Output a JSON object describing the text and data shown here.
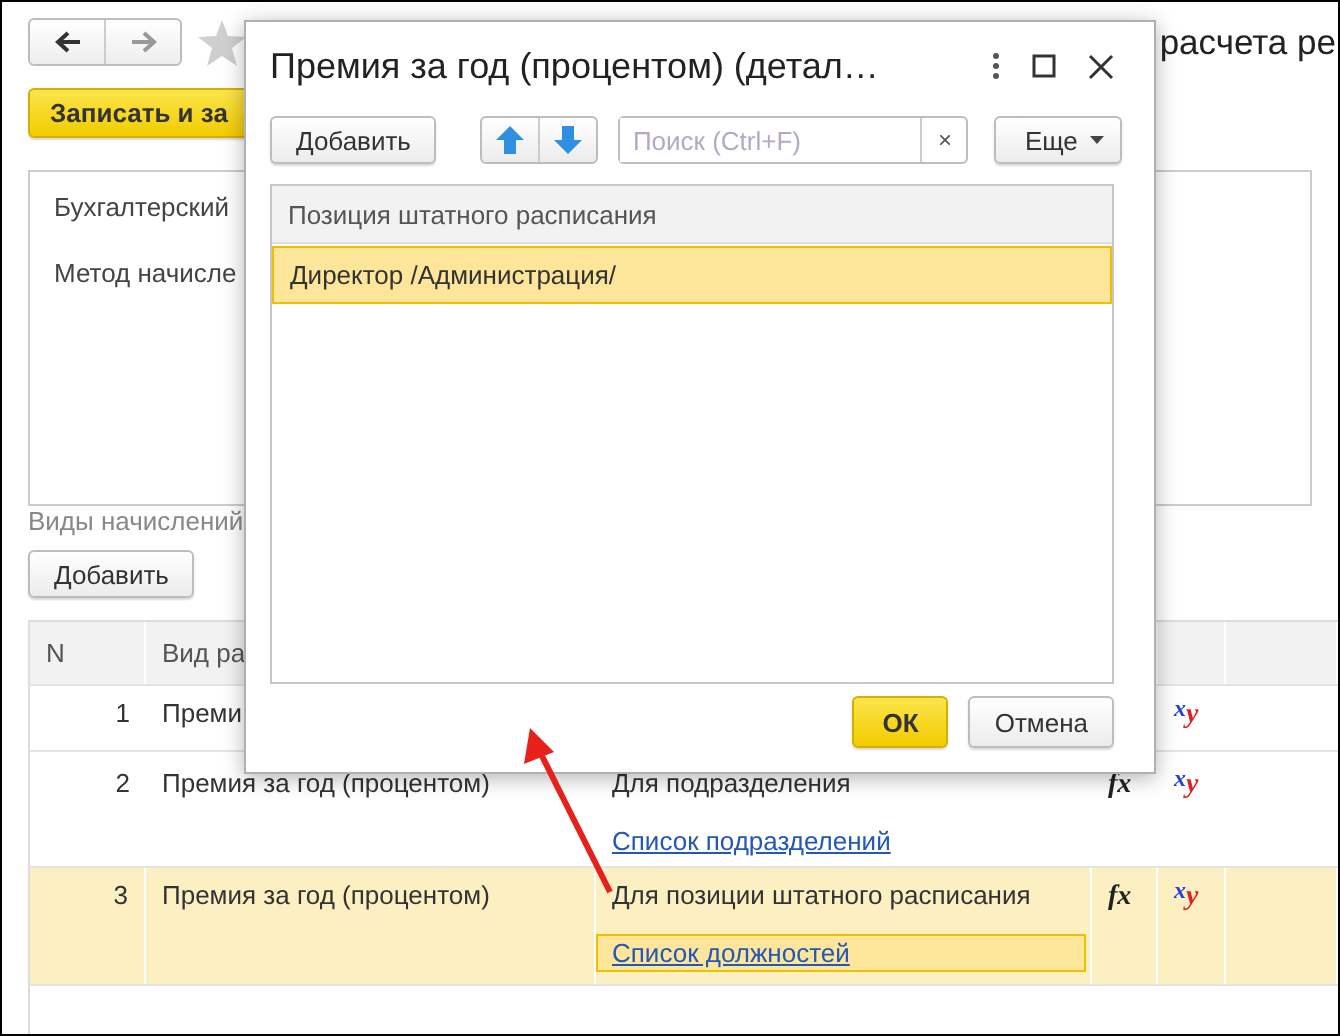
{
  "form": {
    "title": "расчета ре",
    "save_button": "Записать и за",
    "panel_fields": [
      "Бухгалтерский",
      "Метод начисле"
    ],
    "section_label": "Виды начислений",
    "add_button": "Добавить",
    "table": {
      "columns": [
        "N",
        "Вид ра"
      ],
      "rows": [
        {
          "number": "1",
          "accrual": "Преми",
          "variables": "$^{x}$y",
          "selected": false
        },
        {
          "number": "2",
          "accrual": "Премия за год (процентом)",
          "condition": "Для подразделения",
          "formula": "fx",
          "variables": "$^{x}$y",
          "link": {
            "text": "Список подразделений",
            "selected": false
          },
          "selected": false
        },
        {
          "number": "3",
          "accrual": "Премия за год (процентом)",
          "condition": "Для позиции штатного расписания",
          "formula": "fx",
          "variables": "$^{x}$y",
          "link": {
            "text": "Список должностей",
            "selected": true
          },
          "selected": true
        }
      ]
    }
  },
  "dialog": {
    "title": "Премия за год (процентом) (детал…",
    "add_button": "Добавить",
    "search": {
      "placeholder": "Поиск (Ctrl+F)",
      "clear": "×"
    },
    "more_button": "Еще",
    "list": {
      "header": "Позиция штатного расписания",
      "items": [
        {
          "label": "Директор /Администрация/",
          "selected": true
        }
      ]
    },
    "buttons": [
      {
        "label": "ОК",
        "kind": "primary"
      },
      {
        "label": "Отмена",
        "kind": "default"
      }
    ]
  }
}
